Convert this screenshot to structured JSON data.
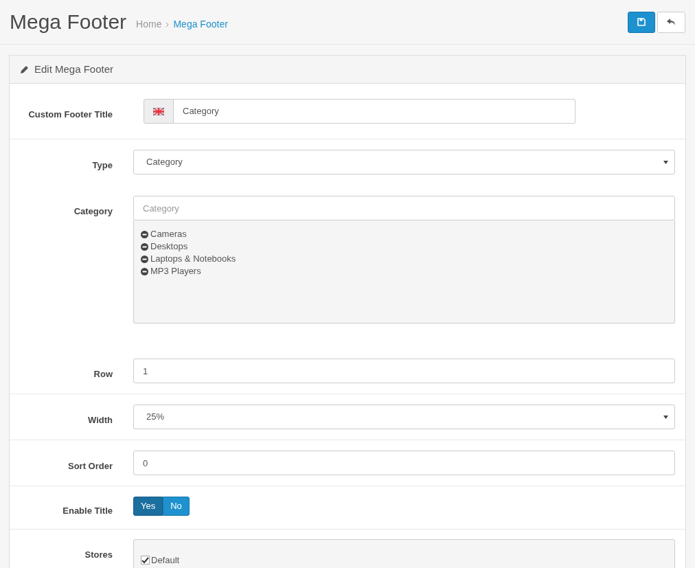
{
  "header": {
    "title": "Mega Footer",
    "breadcrumb": [
      "Home",
      "Mega Footer"
    ]
  },
  "panel": {
    "title": "Edit Mega Footer"
  },
  "fields": [
    {
      "kind": "language_text",
      "label": "Custom Footer Title",
      "value": "Category",
      "divider": true
    },
    {
      "kind": "select",
      "label": "Type",
      "value": "Category",
      "divider": false
    },
    {
      "kind": "autocomplete",
      "label": "Category",
      "placeholder": "Category",
      "items": [
        "Cameras",
        "Desktops",
        "Laptops & Notebooks",
        "MP3 Players"
      ],
      "divider": false
    },
    {
      "kind": "text",
      "label": "Row",
      "value": "1",
      "divider": true
    },
    {
      "kind": "select",
      "label": "Width",
      "value": "25%",
      "divider": true
    },
    {
      "kind": "text",
      "label": "Sort Order",
      "value": "0",
      "divider": true
    },
    {
      "kind": "toggle",
      "label": "Enable Title",
      "options": [
        {
          "label": "Yes",
          "selected": true
        },
        {
          "label": "No",
          "selected": false
        }
      ],
      "divider": true
    },
    {
      "kind": "checklist",
      "label": "Stores",
      "items": [
        {
          "label": "Default",
          "checked": true
        }
      ]
    }
  ]
}
